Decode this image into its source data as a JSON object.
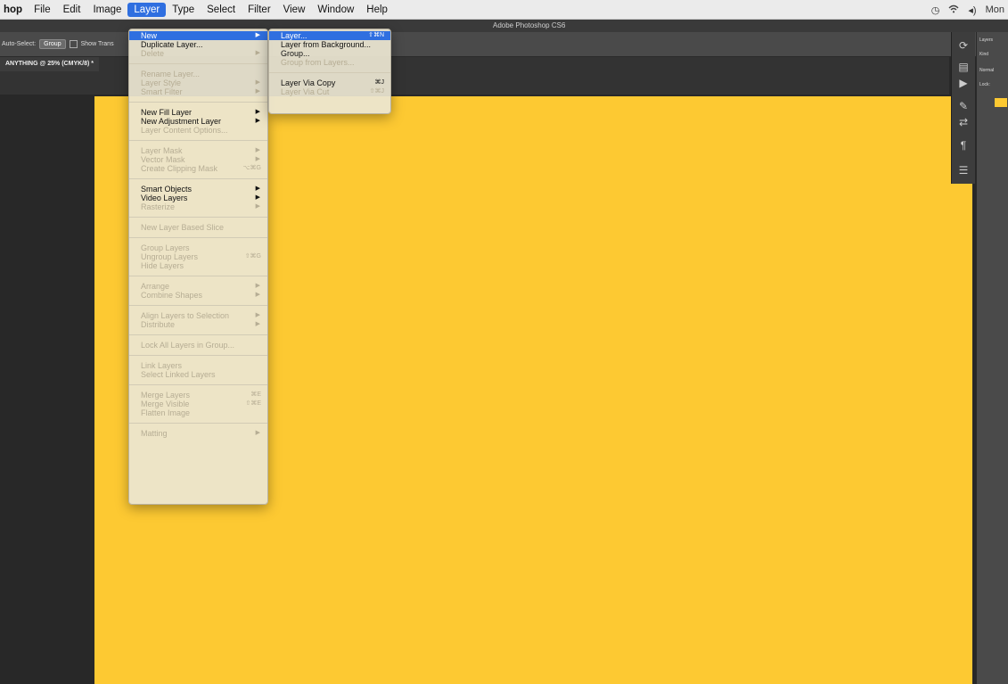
{
  "menubar": {
    "app_name": "hop",
    "items": [
      {
        "label": "File"
      },
      {
        "label": "Edit"
      },
      {
        "label": "Image"
      },
      {
        "label": "Layer"
      },
      {
        "label": "Type"
      },
      {
        "label": "Select"
      },
      {
        "label": "Filter"
      },
      {
        "label": "View"
      },
      {
        "label": "Window"
      },
      {
        "label": "Help"
      }
    ],
    "clock": "Mon",
    "icons": [
      "time-machine-icon",
      "wifi-icon",
      "volume-icon"
    ]
  },
  "window_title": "Adobe Photoshop CS6",
  "options_bar": {
    "auto_select_label": "Auto-Select:",
    "auto_select_value": "Group",
    "show_transform_label": "Show Trans"
  },
  "document_tab": "ANYTHING @ 25% (CMYK/8) *",
  "layer_menu": {
    "items": [
      {
        "label": "New",
        "state": "highlighted",
        "submenu": true
      },
      {
        "label": "Duplicate Layer...",
        "state": "enabled"
      },
      {
        "label": "Delete",
        "state": "disabled",
        "submenu": true
      },
      {
        "sep": true
      },
      {
        "label": "Rename Layer...",
        "state": "disabled"
      },
      {
        "label": "Layer Style",
        "state": "disabled",
        "submenu": true
      },
      {
        "label": "Smart Filter",
        "state": "disabled",
        "submenu": true
      },
      {
        "sep": true
      },
      {
        "label": "New Fill Layer",
        "state": "enabled",
        "submenu": true
      },
      {
        "label": "New Adjustment Layer",
        "state": "enabled",
        "submenu": true
      },
      {
        "label": "Layer Content Options...",
        "state": "disabled"
      },
      {
        "sep": true
      },
      {
        "label": "Layer Mask",
        "state": "disabled",
        "submenu": true
      },
      {
        "label": "Vector Mask",
        "state": "disabled",
        "submenu": true
      },
      {
        "label": "Create Clipping Mask",
        "state": "disabled",
        "shortcut": "⌥⌘G"
      },
      {
        "sep": true
      },
      {
        "label": "Smart Objects",
        "state": "enabled",
        "submenu": true
      },
      {
        "label": "Video Layers",
        "state": "enabled",
        "submenu": true
      },
      {
        "label": "Rasterize",
        "state": "disabled",
        "submenu": true
      },
      {
        "sep": true
      },
      {
        "label": "New Layer Based Slice",
        "state": "disabled"
      },
      {
        "sep": true
      },
      {
        "label": "Group Layers",
        "state": "disabled"
      },
      {
        "label": "Ungroup Layers",
        "state": "disabled",
        "shortcut": "⇧⌘G"
      },
      {
        "label": "Hide Layers",
        "state": "disabled"
      },
      {
        "sep": true
      },
      {
        "label": "Arrange",
        "state": "disabled",
        "submenu": true
      },
      {
        "label": "Combine Shapes",
        "state": "disabled",
        "submenu": true
      },
      {
        "sep": true
      },
      {
        "label": "Align Layers to Selection",
        "state": "disabled",
        "submenu": true
      },
      {
        "label": "Distribute",
        "state": "disabled",
        "submenu": true
      },
      {
        "sep": true
      },
      {
        "label": "Lock All Layers in Group...",
        "state": "disabled"
      },
      {
        "sep": true
      },
      {
        "label": "Link Layers",
        "state": "disabled"
      },
      {
        "label": "Select Linked Layers",
        "state": "disabled"
      },
      {
        "sep": true
      },
      {
        "label": "Merge Layers",
        "state": "disabled",
        "shortcut": "⌘E"
      },
      {
        "label": "Merge Visible",
        "state": "disabled",
        "shortcut": "⇧⌘E"
      },
      {
        "label": "Flatten Image",
        "state": "disabled"
      },
      {
        "sep": true
      },
      {
        "label": "Matting",
        "state": "disabled",
        "submenu": true
      }
    ]
  },
  "new_submenu": {
    "items": [
      {
        "label": "Layer...",
        "state": "highlighted",
        "shortcut": "⇧⌘N"
      },
      {
        "label": "Layer from Background...",
        "state": "enabled"
      },
      {
        "label": "Group...",
        "state": "enabled"
      },
      {
        "label": "Group from Layers...",
        "state": "disabled"
      },
      {
        "sep": true
      },
      {
        "label": "Layer Via Copy",
        "state": "enabled",
        "shortcut": "⌘J"
      },
      {
        "label": "Layer Via Cut",
        "state": "disabled",
        "shortcut": "⇧⌘J"
      }
    ]
  },
  "right_panel": {
    "layers_tab": "Layers",
    "kind_label": "Kind",
    "normal_label": "Normal",
    "lock_label": "Lock:"
  },
  "colors": {
    "canvas": "#fdc932",
    "highlight": "#2f6fe0",
    "workspace": "#282828"
  }
}
